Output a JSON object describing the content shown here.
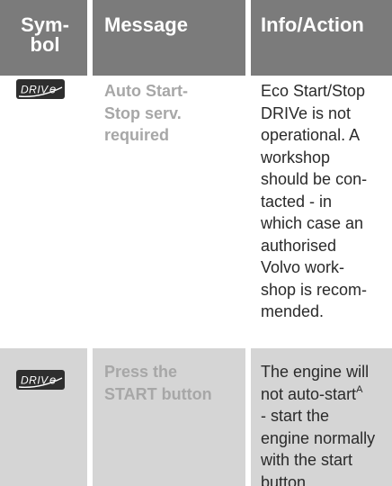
{
  "table": {
    "headers": {
      "symbol_line1": "Sym-",
      "symbol_line2": "bol",
      "message": "Message",
      "info": "Info/Action"
    },
    "rows": [
      {
        "symbol": "DRIVe-icon",
        "message_lines": [
          "Auto Start-",
          "Stop serv.",
          "required"
        ],
        "info_lines": [
          "Eco Start/Stop",
          "DRIVe is not",
          "operational. A",
          "workshop",
          "should be con-",
          "tacted - in",
          "which case an",
          "authorised",
          "Volvo work-",
          "shop is recom-",
          "mended."
        ]
      },
      {
        "symbol": "DRIVe-icon",
        "message_lines": [
          "Press the",
          "START button"
        ],
        "info_line1": "The engine will",
        "info_line2_text": "not auto-start",
        "info_line2_sup": "A",
        "info_rest_lines": [
          "- start the",
          "engine normally",
          "with the start",
          "button."
        ]
      }
    ]
  },
  "colors": {
    "header_bg": "#7b7b7b",
    "header_text": "#ffffff",
    "row2_bg": "#d5d5d5",
    "message_text": "#a7a7a7",
    "info_text": "#2a2a2a",
    "badge_bg": "#2e2e2e"
  }
}
